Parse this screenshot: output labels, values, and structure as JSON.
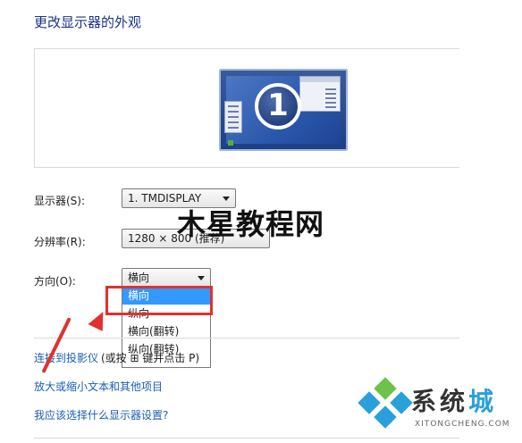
{
  "title": "更改显示器的外观",
  "preview": {
    "monitor_number": "1"
  },
  "fields": {
    "display": {
      "label": "显示器(S):",
      "value": "1. TMDISPLAY"
    },
    "resolution": {
      "label": "分辨率(R):",
      "value": "1280 × 800 (推荐)"
    },
    "orientation": {
      "label": "方向(O):",
      "value": "横向",
      "options": [
        "横向",
        "纵向",
        "横向(翻转)",
        "纵向(翻转)"
      ],
      "highlighted_index": 0
    }
  },
  "watermark": "木星教程网",
  "links": {
    "projector": "连接到投影仪",
    "projector_tail": "(或按 ⊞ 键并点击 P)",
    "text_size": "放大或缩小文本和其他项目",
    "which_settings": "我应该选择什么显示器设置?"
  },
  "brand": {
    "name_prefix": "系统",
    "name_accent": "城",
    "url": "XITONGCHENG.COM"
  },
  "colors": {
    "title": "#1e3287",
    "link": "#1a5fb4",
    "selection": "#3399ff",
    "annotation_red": "#e0312f",
    "brand_blue": "#2aa0db"
  }
}
